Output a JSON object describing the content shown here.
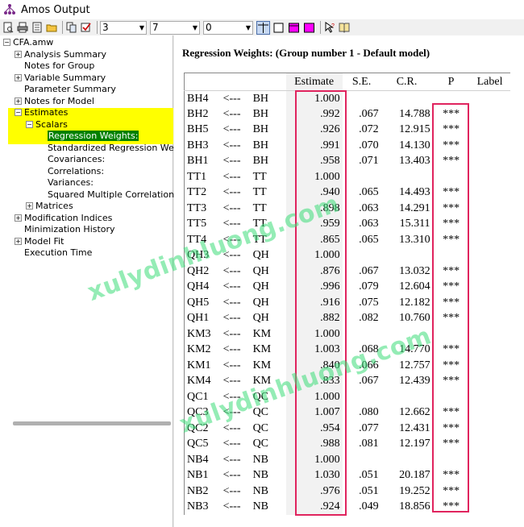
{
  "window": {
    "title": "Amos Output"
  },
  "toolbar": {
    "combos": [
      "3",
      "7",
      "0"
    ]
  },
  "tree": {
    "root": "CFA.amw",
    "items": [
      {
        "label": "Analysis Summary",
        "expander": "+"
      },
      {
        "label": "Notes for Group",
        "expander": ""
      },
      {
        "label": "Variable Summary",
        "expander": "+"
      },
      {
        "label": "Parameter Summary",
        "expander": ""
      },
      {
        "label": "Notes for Model",
        "expander": "+"
      },
      {
        "label": "Estimates",
        "expander": "-"
      },
      {
        "label": "Scalars",
        "expander": "-"
      },
      {
        "label": "Regression Weights:",
        "expander": ""
      },
      {
        "label": "Standardized Regression Weigl",
        "expander": ""
      },
      {
        "label": "Covariances:",
        "expander": ""
      },
      {
        "label": "Correlations:",
        "expander": ""
      },
      {
        "label": "Variances:",
        "expander": ""
      },
      {
        "label": "Squared Multiple Correlations:",
        "expander": ""
      },
      {
        "label": "Matrices",
        "expander": "+"
      },
      {
        "label": "Modification Indices",
        "expander": "+"
      },
      {
        "label": "Minimization History",
        "expander": ""
      },
      {
        "label": "Model Fit",
        "expander": "+"
      },
      {
        "label": "Execution Time",
        "expander": ""
      }
    ]
  },
  "main": {
    "heading": "Regression Weights: (Group number 1 - Default model)",
    "columns": [
      "",
      "",
      "",
      "Estimate",
      "S.E.",
      "C.R.",
      "P",
      "Label"
    ],
    "rows": [
      [
        "BH4",
        "<---",
        "BH",
        "1.000",
        "",
        "",
        "",
        ""
      ],
      [
        "BH2",
        "<---",
        "BH",
        ".992",
        ".067",
        "14.788",
        "***",
        ""
      ],
      [
        "BH5",
        "<---",
        "BH",
        ".926",
        ".072",
        "12.915",
        "***",
        ""
      ],
      [
        "BH3",
        "<---",
        "BH",
        ".991",
        ".070",
        "14.130",
        "***",
        ""
      ],
      [
        "BH1",
        "<---",
        "BH",
        ".958",
        ".071",
        "13.403",
        "***",
        ""
      ],
      [
        "TT1",
        "<---",
        "TT",
        "1.000",
        "",
        "",
        "",
        ""
      ],
      [
        "TT2",
        "<---",
        "TT",
        ".940",
        ".065",
        "14.493",
        "***",
        ""
      ],
      [
        "TT3",
        "<---",
        "TT",
        ".898",
        ".063",
        "14.291",
        "***",
        ""
      ],
      [
        "TT5",
        "<---",
        "TT",
        ".959",
        ".063",
        "15.311",
        "***",
        ""
      ],
      [
        "TT4",
        "<---",
        "TT",
        ".865",
        ".065",
        "13.310",
        "***",
        ""
      ],
      [
        "QH3",
        "<---",
        "QH",
        "1.000",
        "",
        "",
        "",
        ""
      ],
      [
        "QH2",
        "<---",
        "QH",
        ".876",
        ".067",
        "13.032",
        "***",
        ""
      ],
      [
        "QH4",
        "<---",
        "QH",
        ".996",
        ".079",
        "12.604",
        "***",
        ""
      ],
      [
        "QH5",
        "<---",
        "QH",
        ".916",
        ".075",
        "12.182",
        "***",
        ""
      ],
      [
        "QH1",
        "<---",
        "QH",
        ".882",
        ".082",
        "10.760",
        "***",
        ""
      ],
      [
        "KM3",
        "<---",
        "KM",
        "1.000",
        "",
        "",
        "",
        ""
      ],
      [
        "KM2",
        "<---",
        "KM",
        "1.003",
        ".068",
        "14.770",
        "***",
        ""
      ],
      [
        "KM1",
        "<---",
        "KM",
        ".840",
        ".066",
        "12.757",
        "***",
        ""
      ],
      [
        "KM4",
        "<---",
        "KM",
        ".833",
        ".067",
        "12.439",
        "***",
        ""
      ],
      [
        "QC1",
        "<---",
        "QC",
        "1.000",
        "",
        "",
        "",
        ""
      ],
      [
        "QC3",
        "<---",
        "QC",
        "1.007",
        ".080",
        "12.662",
        "***",
        ""
      ],
      [
        "QC2",
        "<---",
        "QC",
        ".954",
        ".077",
        "12.431",
        "***",
        ""
      ],
      [
        "QC5",
        "<---",
        "QC",
        ".988",
        ".081",
        "12.197",
        "***",
        ""
      ],
      [
        "NB4",
        "<---",
        "NB",
        "1.000",
        "",
        "",
        "",
        ""
      ],
      [
        "NB1",
        "<---",
        "NB",
        "1.030",
        ".051",
        "20.187",
        "***",
        ""
      ],
      [
        "NB2",
        "<---",
        "NB",
        ".976",
        ".051",
        "19.252",
        "***",
        ""
      ],
      [
        "NB3",
        "<---",
        "NB",
        ".924",
        ".049",
        "18.856",
        "***",
        ""
      ]
    ]
  },
  "watermark": "xulydinhluong.com",
  "colors": {
    "selection": "#008000",
    "highlight": "#ffff00",
    "annotation_box": "#e0245e",
    "watermark": "#3cdc78"
  }
}
